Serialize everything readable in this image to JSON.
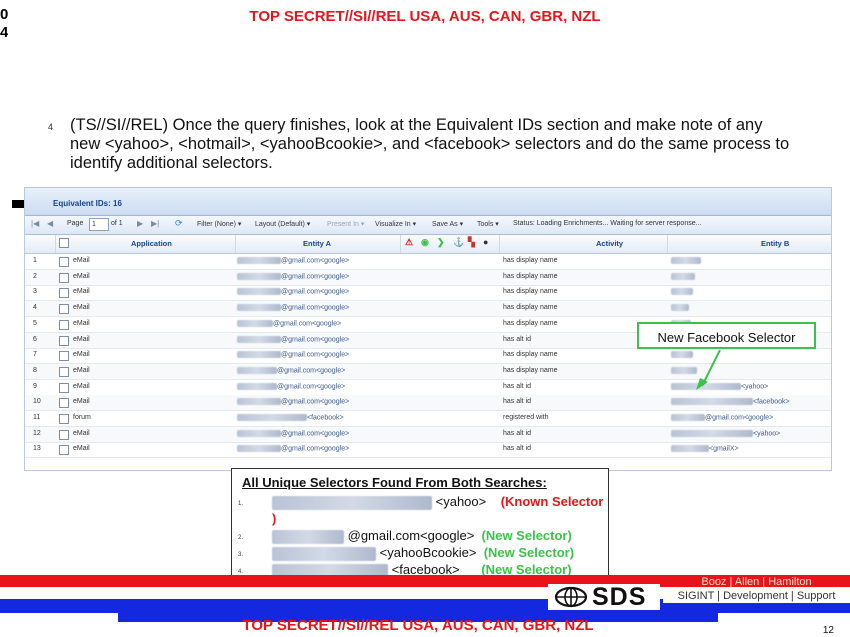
{
  "classification_top": "TOP SECRET//SI//REL USA, AUS, CAN, GBR, NZL",
  "classification_bottom": "TOP SECRET//SI//REL USA, AUS, CAN, GBR, NZL",
  "corner_glyphs": [
    "0",
    "4"
  ],
  "step": {
    "number": "4",
    "text": "(TS//SI//REL) Once the query finishes, look at the Equivalent IDs section and make note of any new <yahoo>, <hotmail>, <yahooBcookie>, and <facebook> selectors and do the same process to identify additional selectors."
  },
  "grid": {
    "title": "Equivalent IDs: 16",
    "toolbar": {
      "page_label": "Page",
      "page_value": "1",
      "of_label": "of 1",
      "filter": "Filter (None) ▾",
      "layout": "Layout (Default) ▾",
      "present_in": "Present In ▾",
      "visualize_in": "Visualize In ▾",
      "save_as": "Save As ▾",
      "tools": "Tools ▾",
      "status": "Status: Loading Enrichments... Waiting for server response..."
    },
    "headers": {
      "application": "Application",
      "entity_a": "Entity A",
      "activity": "Activity",
      "entity_b": "Entity B"
    },
    "rows": [
      {
        "n": "1",
        "app": "eMail",
        "entity_a": "@gmail.com<google>",
        "activity": "has display name",
        "entity_b": ""
      },
      {
        "n": "2",
        "app": "eMail",
        "entity_a": "@gmail.com<google>",
        "activity": "has display name",
        "entity_b": ""
      },
      {
        "n": "3",
        "app": "eMail",
        "entity_a": "@gmail.com<google>",
        "activity": "has display name",
        "entity_b": ""
      },
      {
        "n": "4",
        "app": "eMail",
        "entity_a": "@gmail.com<google>",
        "activity": "has display name",
        "entity_b": ""
      },
      {
        "n": "5",
        "app": "eMail",
        "entity_a": "@gmail.com<google>",
        "activity": "has display name",
        "entity_b": ""
      },
      {
        "n": "6",
        "app": "eMail",
        "entity_a": "@gmail.com<google>",
        "activity": "has alt id",
        "entity_b": ""
      },
      {
        "n": "7",
        "app": "eMail",
        "entity_a": "@gmail.com<google>",
        "activity": "has display name",
        "entity_b": ""
      },
      {
        "n": "8",
        "app": "eMail",
        "entity_a": "@gmail.com<google>",
        "activity": "has display name",
        "entity_b": ""
      },
      {
        "n": "9",
        "app": "eMail",
        "entity_a": "@gmail.com<google>",
        "activity": "has alt id",
        "entity_b": "<yahoo>"
      },
      {
        "n": "10",
        "app": "eMail",
        "entity_a": "@gmail.com<google>",
        "activity": "has alt id",
        "entity_b": "<facebook>"
      },
      {
        "n": "11",
        "app": "forum",
        "entity_a": "<facebook>",
        "activity": "registered with",
        "entity_b": "@gmail.com<google>"
      },
      {
        "n": "12",
        "app": "eMail",
        "entity_a": "@gmail.com<google>",
        "activity": "has alt id",
        "entity_b": "<yahoo>"
      },
      {
        "n": "13",
        "app": "eMail",
        "entity_a": "@gmail.com<google>",
        "activity": "has alt id",
        "entity_b": "<gmailX>"
      }
    ]
  },
  "callout": "New Facebook Selector",
  "summary": {
    "title": "All Unique Selectors Found From Both Searches:",
    "items": [
      {
        "n": "1.",
        "value": "<yahoo>",
        "tag": "(Known Selector",
        "tag_tail": ")",
        "tag_color": "#e8141a"
      },
      {
        "n": "2.",
        "value": "@gmail.com<google>",
        "tag": "(New Selector)",
        "tag_color": "#3bc24a"
      },
      {
        "n": "3.",
        "value": "<yahooBcookie>",
        "tag": "(New Selector)",
        "tag_color": "#3bc24a"
      },
      {
        "n": "4.",
        "value": "<facebook>",
        "tag": "(New Selector)",
        "tag_color": "#3bc24a"
      }
    ]
  },
  "footer": {
    "logo": "SDS",
    "booz": "Booz | Allen | Hamilton",
    "sigint": "SIGINT | Development | Support",
    "page_number": "12"
  },
  "colors": {
    "classification_red": "#e8141a",
    "new_selector_green": "#3bc24a",
    "stripe_blue": "#1428e0"
  }
}
